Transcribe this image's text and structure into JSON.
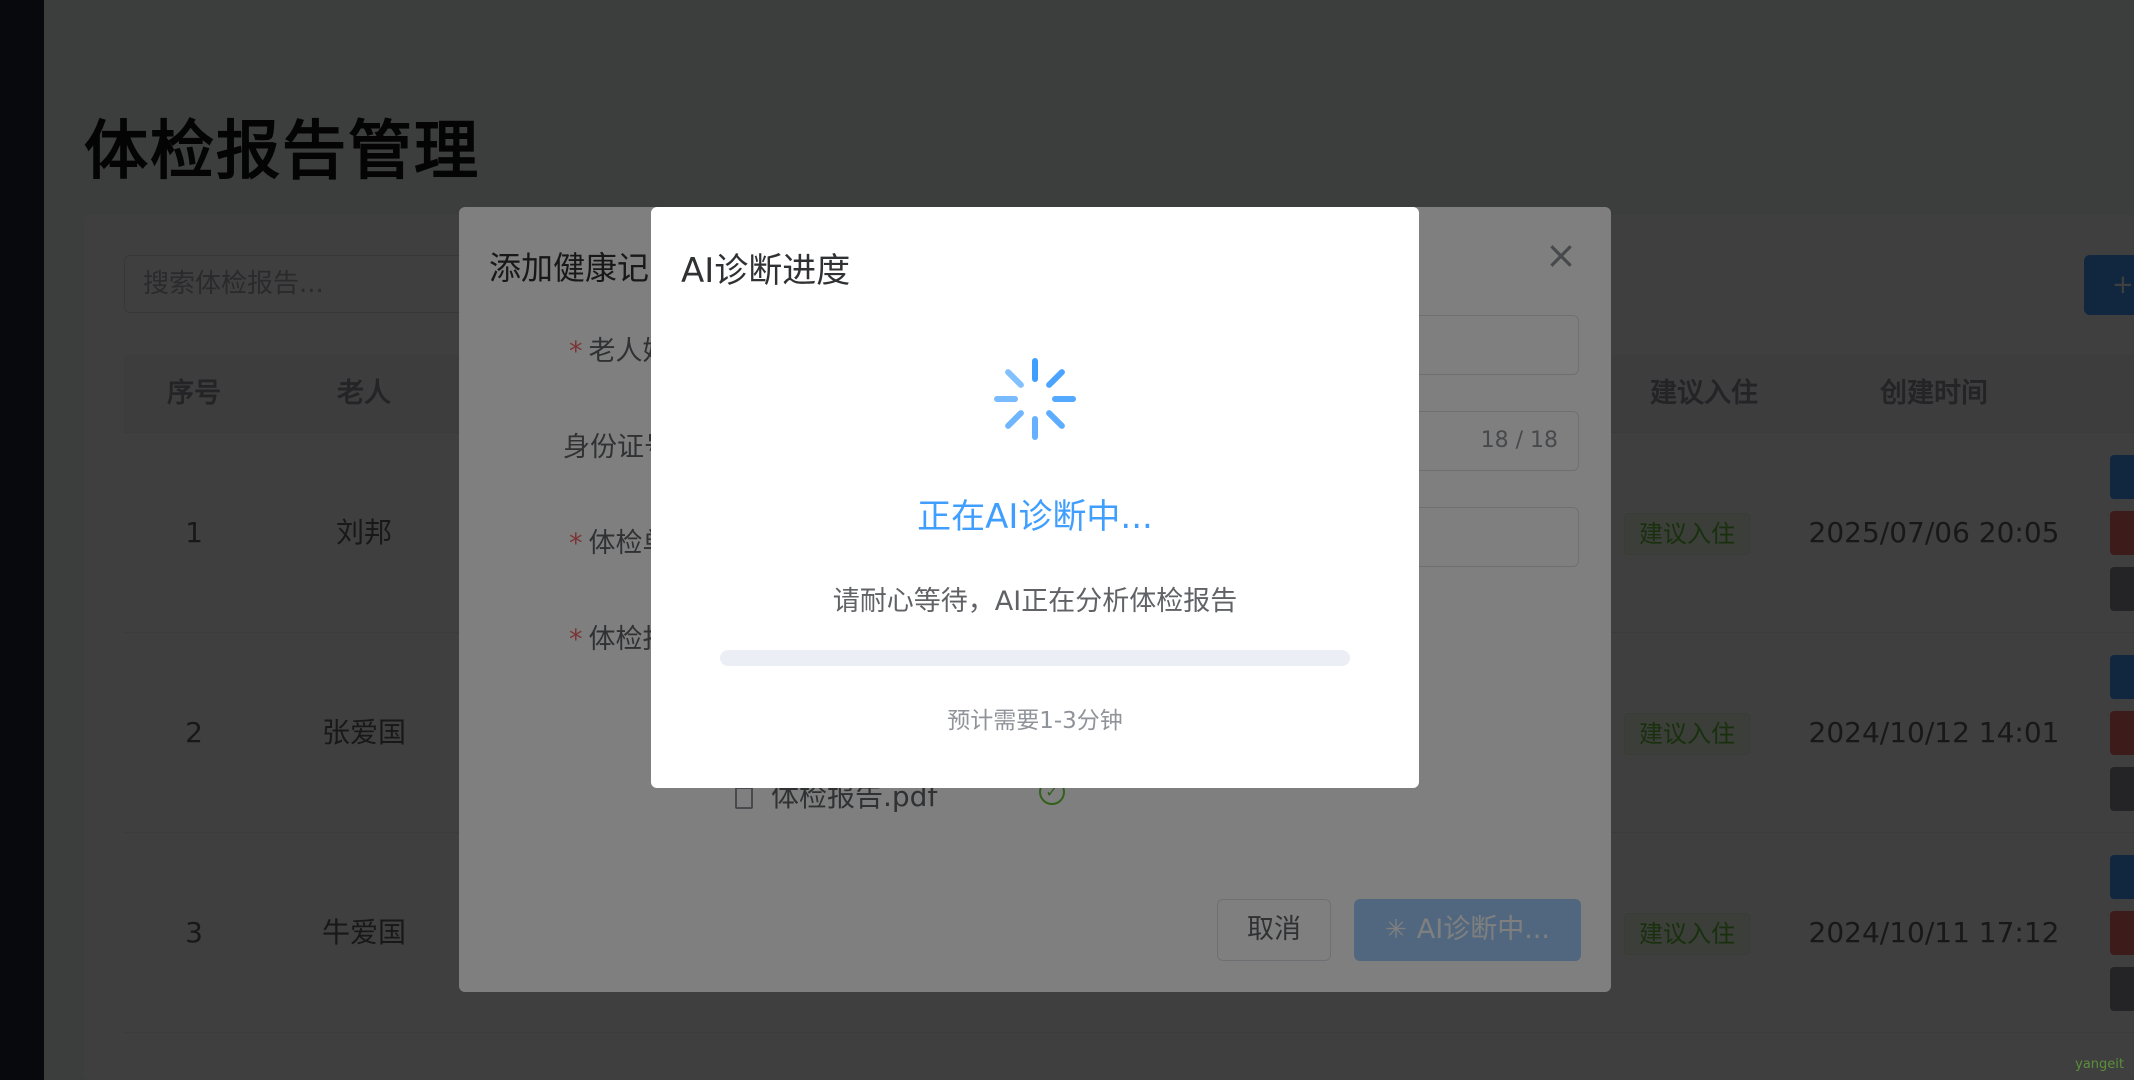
{
  "page": {
    "title": "体检报告管理"
  },
  "list": {
    "search_placeholder": "搜索体检报告...",
    "add_label": "+",
    "columns": {
      "index": "序号",
      "elder": "老人",
      "recommend": "建议入住",
      "created": "创建时间"
    },
    "rows": [
      {
        "index": "1",
        "elder": "刘邦",
        "recommend": "建议入住",
        "created": "2025/07/06 20:05"
      },
      {
        "index": "2",
        "elder": "张爱国",
        "recommend": "建议入住",
        "created": "2024/10/12 14:01"
      },
      {
        "index": "3",
        "elder": "牛爱国",
        "recommend": "建议入住",
        "created": "2024/10/11 17:12"
      }
    ]
  },
  "add_dialog": {
    "title": "添加健康记",
    "close_icon": "close-icon",
    "labels": {
      "elder": "老人姓",
      "id": "身份证号",
      "unit": "体检单",
      "report": "体检报"
    },
    "required_mark": "*",
    "id_count": "18 / 18",
    "file_name": "体检报告.pdf",
    "cancel_label": "取消",
    "submit_label": "AI诊断中..."
  },
  "progress_dialog": {
    "title": "AI诊断进度",
    "status": "正在AI诊断中...",
    "tip": "请耐心等待，AI正在分析体检报告",
    "progress": 0,
    "eta": "预计需要1-3分钟",
    "accent": "#409eff"
  },
  "watermark": "yangeit"
}
